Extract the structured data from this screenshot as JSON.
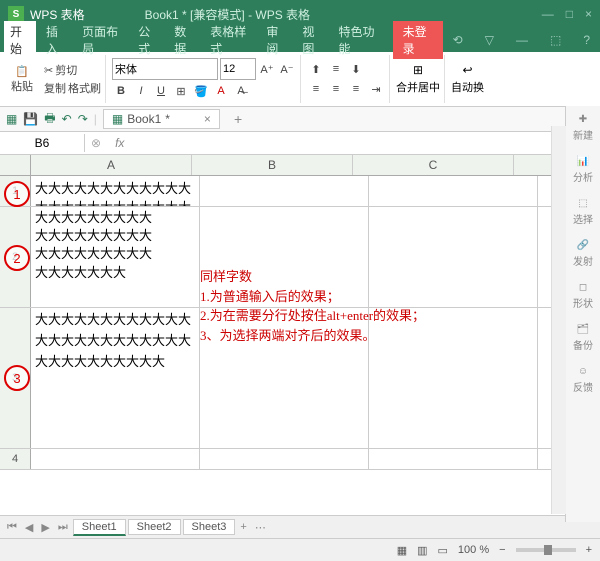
{
  "title": {
    "app": "WPS 表格",
    "doc": "Book1 * [兼容模式]",
    "suffix": "- WPS 表格"
  },
  "menu": {
    "items": [
      "开始",
      "插入",
      "页面布局",
      "公式",
      "数据",
      "表格样式",
      "审阅",
      "视图",
      "特色功能"
    ],
    "login": "未登录"
  },
  "ribbon": {
    "paste": "粘贴",
    "cut": "剪切",
    "copy": "复制",
    "fmtpaint": "格式刷",
    "font": "宋体",
    "size": "12",
    "merge": "合并居中",
    "wrap": "自动换"
  },
  "qat": {
    "book": "Book1"
  },
  "namebox": {
    "ref": "B6",
    "fx": "fx"
  },
  "cols": [
    "A",
    "B",
    "C"
  ],
  "cells": {
    "a1": "大大大大大大大大大大大大大大大大大大大大大大大大大大大大大大大大大大",
    "a2": "大大大大大大大大大\n大大大大大大大大大\n大大大大大大大大大\n大大大大大大大",
    "a3": "大大大大大大大大大大大大大大大大大大大大大大大大大大大大大大大大大大"
  },
  "annot": {
    "c1": "1",
    "c2": "2",
    "c3": "3"
  },
  "note": {
    "l0": "同样字数",
    "l1": "1.为普通输入后的效果；",
    "l2": "2.为在需要分行处按住alt+enter的效果；",
    "l3": "3、为选择两端对齐后的效果。"
  },
  "sheets": {
    "s1": "Sheet1",
    "s2": "Sheet2",
    "s3": "Sheet3"
  },
  "status": {
    "zoom": "100 %"
  },
  "side": {
    "new": "新建",
    "ana": "分析",
    "sel": "选择",
    "emit": "发射",
    "shape": "形状",
    "bak": "备份",
    "fb": "反馈"
  }
}
